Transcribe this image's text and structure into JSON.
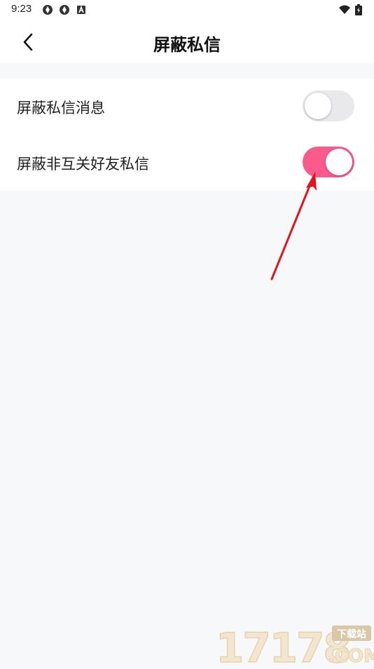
{
  "status_bar": {
    "time": "9:23",
    "left_icons": [
      "aperture-icon",
      "aperture-icon",
      "app-a-icon"
    ],
    "right_icons": [
      "wifi-icon",
      "battery-charging-icon"
    ]
  },
  "nav": {
    "title": "屏蔽私信",
    "back_icon": "chevron-left-icon"
  },
  "settings": [
    {
      "label": "屏蔽私信消息",
      "enabled": false
    },
    {
      "label": "屏蔽非互关好友私信",
      "enabled": true
    }
  ],
  "colors": {
    "toggle_on": "#fa5a8c",
    "toggle_off": "#e9e9eb",
    "annotation_arrow": "#e0161e",
    "page_background": "#f7f8fa"
  },
  "watermark": {
    "number": "17178",
    "badge": "下载站",
    "domain": ".COM"
  }
}
